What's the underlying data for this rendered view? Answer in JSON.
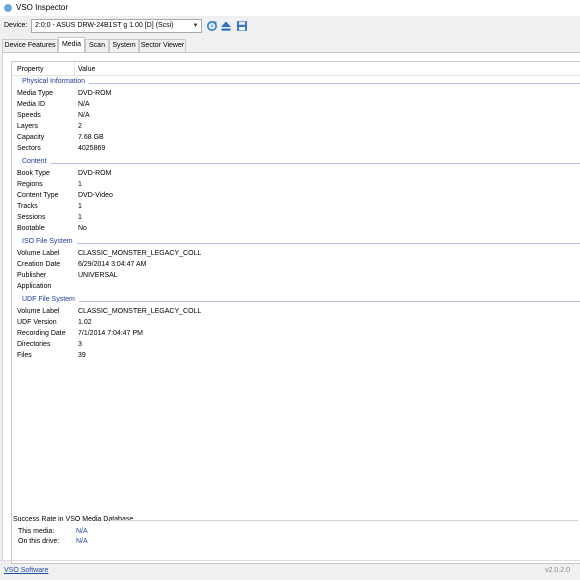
{
  "window": {
    "title": "VSO Inspector"
  },
  "device": {
    "label": "Device:",
    "selected": "2:0:0 - ASUS DRW-24B1ST   g 1.00 [D] (Scsi)"
  },
  "tabs": [
    "Device Features",
    "Media",
    "Scan",
    "System",
    "Sector Viewer"
  ],
  "active_tab": "Media",
  "table": {
    "col_property": "Property",
    "col_value": "Value",
    "physical": {
      "title": "Physical Information",
      "rows": [
        {
          "k": "Media Type",
          "v": "DVD-ROM"
        },
        {
          "k": "Media ID",
          "v": "N/A"
        },
        {
          "k": "Speeds",
          "v": "N/A"
        },
        {
          "k": "Layers",
          "v": "2"
        },
        {
          "k": "Capacity",
          "v": "7.68 GB"
        },
        {
          "k": "Sectors",
          "v": "4025869"
        }
      ]
    },
    "content": {
      "title": "Content",
      "rows": [
        {
          "k": "Book Type",
          "v": "DVD-ROM"
        },
        {
          "k": "Regions",
          "v": "1"
        },
        {
          "k": "Content Type",
          "v": "DVD-Video"
        },
        {
          "k": "Tracks",
          "v": "1"
        },
        {
          "k": "Sessions",
          "v": "1"
        },
        {
          "k": "Bootable",
          "v": "No"
        }
      ]
    },
    "iso": {
      "title": "ISO File System",
      "rows": [
        {
          "k": "Volume Label",
          "v": "CLASSIC_MONSTER_LEGACY_COLL"
        },
        {
          "k": "Creation Date",
          "v": "6/29/2014 3:04:47 AM"
        },
        {
          "k": "Publisher",
          "v": "UNIVERSAL"
        },
        {
          "k": "Application",
          "v": ""
        }
      ]
    },
    "udf": {
      "title": "UDF File System",
      "rows": [
        {
          "k": "Volume Label",
          "v": "CLASSIC_MONSTER_LEGACY_COLL"
        },
        {
          "k": "UDF Version",
          "v": "1.02"
        },
        {
          "k": "Recording Date",
          "v": "7/1/2014 7:04:47 PM"
        },
        {
          "k": "Directories",
          "v": "3"
        },
        {
          "k": "Files",
          "v": "39"
        }
      ]
    }
  },
  "success": {
    "title": "Success Rate in VSO Media Database",
    "this_media_label": "This media:",
    "this_media_value": "N/A",
    "this_drive_label": "On this drive:",
    "this_drive_value": "N/A"
  },
  "footer": {
    "link": "VSO Software",
    "version": "v2.0.2.0"
  },
  "icons": [
    "app-disc-icon",
    "refresh-icon",
    "eject-icon",
    "save-icon",
    "chevron-down-icon"
  ]
}
